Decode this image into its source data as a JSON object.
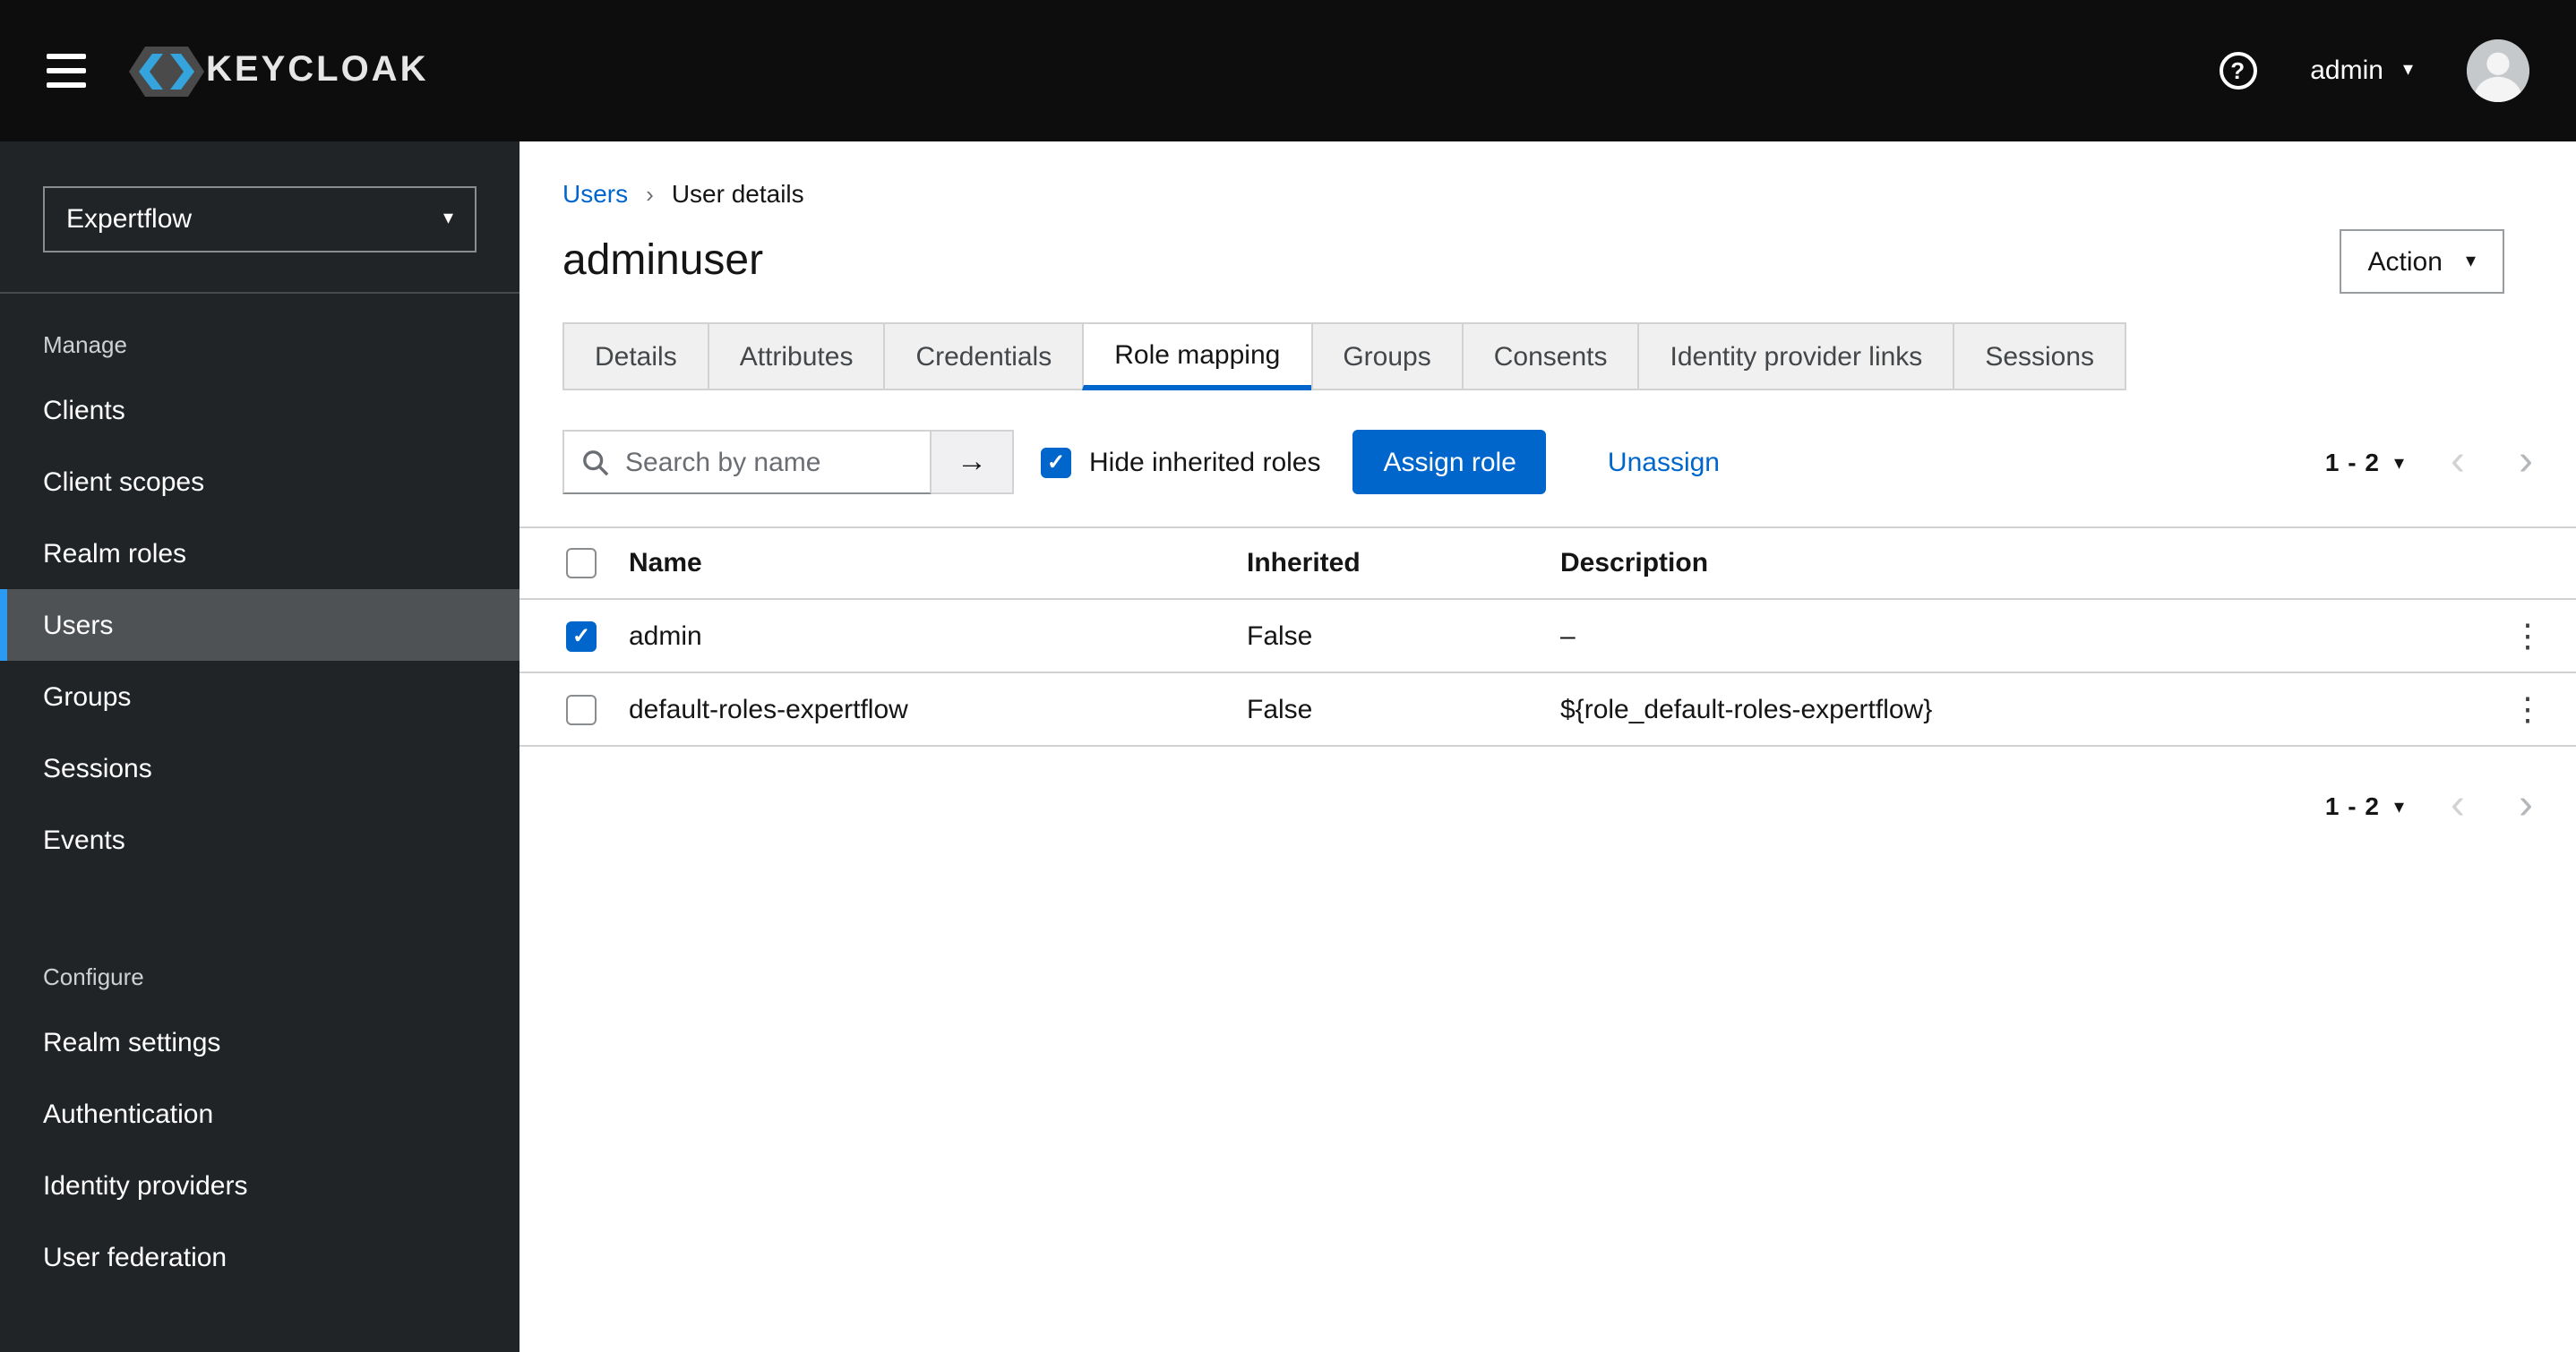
{
  "icons": {
    "question": "?",
    "caret_down": "▾",
    "chevron_left": "‹",
    "chevron_right": "›",
    "breadcrumb_sep": "›",
    "arrow_right": "→",
    "check": "✓",
    "kebab": "⋮"
  },
  "header": {
    "brand": "KEYCLOAK",
    "username": "admin"
  },
  "sidebar": {
    "realm": "Expertflow",
    "sections": [
      {
        "label": "Manage",
        "items": [
          {
            "label": "Clients",
            "selected": false
          },
          {
            "label": "Client scopes",
            "selected": false
          },
          {
            "label": "Realm roles",
            "selected": false
          },
          {
            "label": "Users",
            "selected": true
          },
          {
            "label": "Groups",
            "selected": false
          },
          {
            "label": "Sessions",
            "selected": false
          },
          {
            "label": "Events",
            "selected": false
          }
        ]
      },
      {
        "label": "Configure",
        "items": [
          {
            "label": "Realm settings",
            "selected": false
          },
          {
            "label": "Authentication",
            "selected": false
          },
          {
            "label": "Identity providers",
            "selected": false
          },
          {
            "label": "User federation",
            "selected": false
          }
        ]
      }
    ]
  },
  "breadcrumb": {
    "parent": "Users",
    "current": "User details"
  },
  "page": {
    "title": "adminuser",
    "action_label": "Action"
  },
  "tabs": [
    {
      "label": "Details",
      "active": false
    },
    {
      "label": "Attributes",
      "active": false
    },
    {
      "label": "Credentials",
      "active": false
    },
    {
      "label": "Role mapping",
      "active": true
    },
    {
      "label": "Groups",
      "active": false
    },
    {
      "label": "Consents",
      "active": false
    },
    {
      "label": "Identity provider links",
      "active": false
    },
    {
      "label": "Sessions",
      "active": false
    }
  ],
  "toolbar": {
    "search_placeholder": "Search by name",
    "hide_inherited_label": "Hide inherited roles",
    "hide_inherited_checked": true,
    "assign_label": "Assign role",
    "unassign_label": "Unassign",
    "pagination_label": "1 - 2"
  },
  "table": {
    "header_checked": false,
    "columns": {
      "name": "Name",
      "inherited": "Inherited",
      "description": "Description"
    },
    "rows": [
      {
        "checked": true,
        "name": "admin",
        "inherited": "False",
        "description": "–"
      },
      {
        "checked": false,
        "name": "default-roles-expertflow",
        "inherited": "False",
        "description": "${role_default-roles-expertflow}"
      }
    ]
  },
  "footer": {
    "pagination_label": "1 - 2"
  },
  "colors": {
    "accent_blue": "#0066cc",
    "nav_indicator_blue": "#2b9af3",
    "masthead_bg": "#0d0d0d",
    "sidebar_bg": "#212427",
    "selected_nav_bg": "#4f5255"
  }
}
